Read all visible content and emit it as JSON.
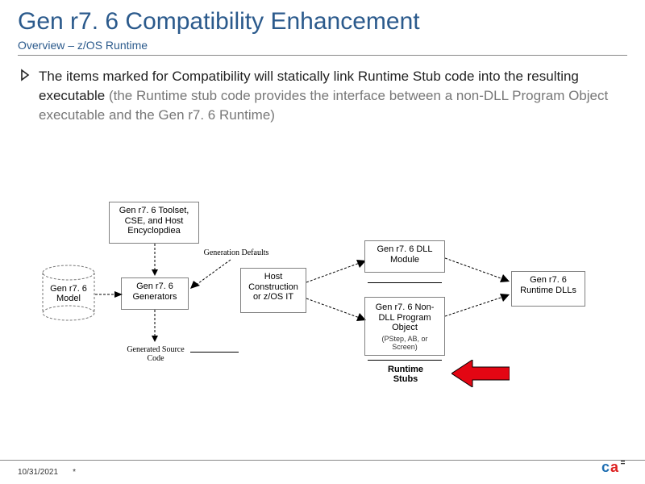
{
  "slide": {
    "title": "Gen r7. 6 Compatibility Enhancement",
    "subtitle": "Overview – z/OS Runtime",
    "bullet_main": "The items marked for Compatibility will statically link Runtime Stub code into the resulting executable ",
    "bullet_gray": "(the Runtime stub code provides the interface between a non-DLL Program Object executable and the Gen r7. 6 Runtime)"
  },
  "diagram": {
    "box_toolset": "Gen r7. 6 Toolset, CSE, and Host Encyclopdiea",
    "box_model": "Gen r7. 6 Model",
    "box_generators": "Gen r7. 6 Generators",
    "box_host": "Host Construction or z/OS IT",
    "box_dll": "Gen r7. 6 DLL Module",
    "box_pobj_top": "Gen r7. 6 Non-DLL Program Object",
    "box_pobj_sub": "(PStep, AB, or Screen)",
    "box_rt": "Gen r7. 6 Runtime DLLs",
    "lbl_gendefs": "Generation Defaults",
    "lbl_gensrc": "Generated Source Code",
    "lbl_rtstubs": "Runtime Stubs"
  },
  "footer": {
    "date": "10/31/2021",
    "mark": "*"
  },
  "logo": {
    "text": "ca"
  }
}
